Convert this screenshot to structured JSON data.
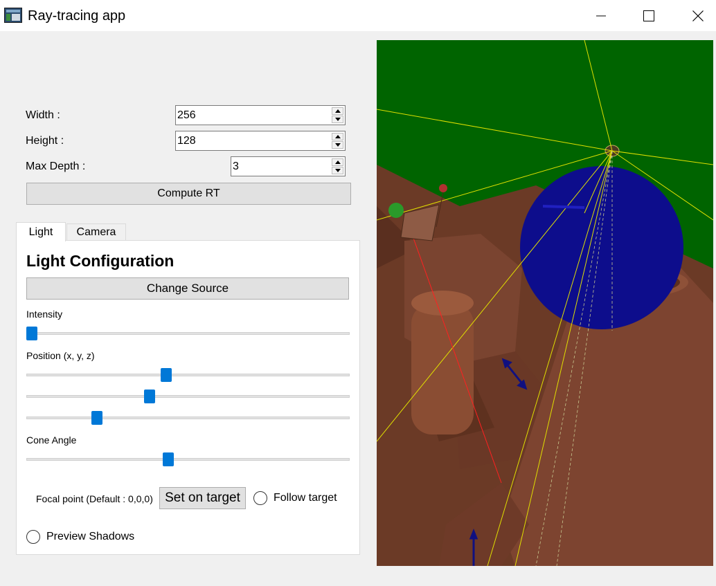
{
  "window": {
    "title": "Ray-tracing app"
  },
  "render_settings": {
    "width_label": "Width  :",
    "width_value": "256",
    "height_label": "Height :",
    "height_value": "128",
    "depth_label": "Max Depth :",
    "depth_value": "3",
    "compute_label": "Compute RT"
  },
  "tabs": {
    "light": "Light",
    "camera": "Camera"
  },
  "light": {
    "heading": "Light Configuration",
    "change_source": "Change Source",
    "intensity_label": "Intensity",
    "intensity_value": 0.0,
    "position_label": "Position (x, y, z)",
    "position_values": [
      0.43,
      0.377,
      0.208
    ],
    "cone_label": "Cone Angle",
    "cone_value": 0.437,
    "focal_label": "Focal point (Default : 0,0,0)",
    "set_on_target": "Set on target",
    "follow_target": "Follow target",
    "follow_checked": false,
    "preview_shadows": "Preview Shadows",
    "preview_checked": false
  },
  "colors": {
    "accent": "#0078d7",
    "scene_background": "#006400",
    "floor_brown": "#6b3a26",
    "sphere_blue": "#0d0d8c",
    "ray_yellow": "#e0e000",
    "ray_red": "#ff2020"
  }
}
